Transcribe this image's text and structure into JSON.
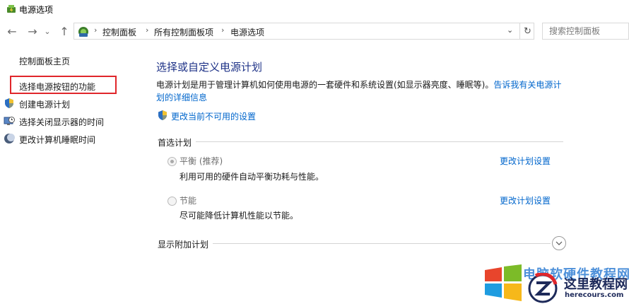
{
  "window": {
    "title": "电源选项"
  },
  "nav": {
    "back_glyph": "←",
    "forward_glyph": "→",
    "recent_glyph": "⌄",
    "up_glyph": "↑",
    "breadcrumb": [
      "控制面板",
      "所有控制面板项",
      "电源选项"
    ],
    "separator": "›",
    "dropdown_glyph": "⌄",
    "refresh_glyph": "↻",
    "search_placeholder": "搜索控制面板"
  },
  "sidebar": {
    "home": "控制面板主页",
    "items": [
      {
        "label": "选择电源按钮的功能",
        "icon": "none",
        "highlighted": true
      },
      {
        "label": "创建电源计划",
        "icon": "shield-icon"
      },
      {
        "label": "选择关闭显示器的时间",
        "icon": "monitor-clock-icon"
      },
      {
        "label": "更改计算机睡眠时间",
        "icon": "moon-icon"
      }
    ]
  },
  "main": {
    "heading": "选择或自定义电源计划",
    "description": "电源计划是用于管理计算机如何使用电源的一套硬件和系统设置(如显示器亮度、睡眠等)。",
    "description_link": "告诉我有关电源计划的详细信息",
    "change_unavailable": "更改当前不可用的设置",
    "preferred_group": "首选计划",
    "plans": [
      {
        "name": "平衡 (推荐)",
        "description": "利用可用的硬件自动平衡功耗与性能。",
        "link": "更改计划设置",
        "selected": true
      },
      {
        "name": "节能",
        "description": "尽可能降低计算机性能以节能。",
        "link": "更改计划设置",
        "selected": false
      }
    ],
    "additional_group": "显示附加计划"
  },
  "watermark": {
    "top_text": "电脑软硬件教程网",
    "cn_text": "这里教程网",
    "en_text": "herecours.com"
  },
  "colors": {
    "heading": "#1e3287",
    "link": "#0066cc",
    "highlight": "#e0262b"
  }
}
